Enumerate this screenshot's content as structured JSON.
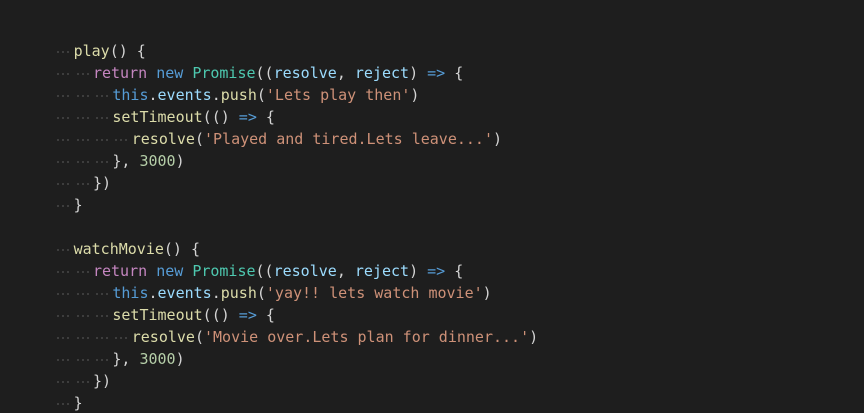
{
  "colors": {
    "background": "#1e1e1e",
    "function": "#dcdcaa",
    "keyword": "#c586c0",
    "storage": "#569cd6",
    "class": "#4ec9b0",
    "parameter": "#9cdcfe",
    "string": "#ce9178",
    "number": "#b5cea8",
    "punctuation": "#d4d4d4"
  },
  "code": {
    "l1": {
      "fn": "play",
      "p1": "() {"
    },
    "l2": {
      "kw": "return",
      "new": "new",
      "cls": "Promise",
      "p1": "((",
      "param1": "resolve",
      "p2": ", ",
      "param2": "reject",
      "p3": ") ",
      "arrow": "=>",
      "p4": " {"
    },
    "l3": {
      "this": "this",
      "p1": ".",
      "prop": "events",
      "p2": ".",
      "fn": "push",
      "p3": "(",
      "str": "'Lets play then'",
      "p4": ")"
    },
    "l4": {
      "fn": "setTimeout",
      "p1": "(() ",
      "arrow": "=>",
      "p2": " {"
    },
    "l5": {
      "fn": "resolve",
      "p1": "(",
      "str": "'Played and tired.Lets leave...'",
      "p2": ")"
    },
    "l6": {
      "p1": "}, ",
      "num": "3000",
      "p2": ")"
    },
    "l7": {
      "p1": "})"
    },
    "l8": {
      "p1": "}"
    },
    "l10": {
      "fn": "watchMovie",
      "p1": "() {"
    },
    "l11": {
      "kw": "return",
      "new": "new",
      "cls": "Promise",
      "p1": "((",
      "param1": "resolve",
      "p2": ", ",
      "param2": "reject",
      "p3": ") ",
      "arrow": "=>",
      "p4": " {"
    },
    "l12": {
      "this": "this",
      "p1": ".",
      "prop": "events",
      "p2": ".",
      "fn": "push",
      "p3": "(",
      "str": "'yay!! lets watch movie'",
      "p4": ")"
    },
    "l13": {
      "fn": "setTimeout",
      "p1": "(() ",
      "arrow": "=>",
      "p2": " {"
    },
    "l14": {
      "fn": "resolve",
      "p1": "(",
      "str": "'Movie over.Lets plan for dinner...'",
      "p2": ")"
    },
    "l15": {
      "p1": "}, ",
      "num": "3000",
      "p2": ")"
    },
    "l16": {
      "p1": "})"
    },
    "l17": {
      "p1": "}"
    }
  }
}
